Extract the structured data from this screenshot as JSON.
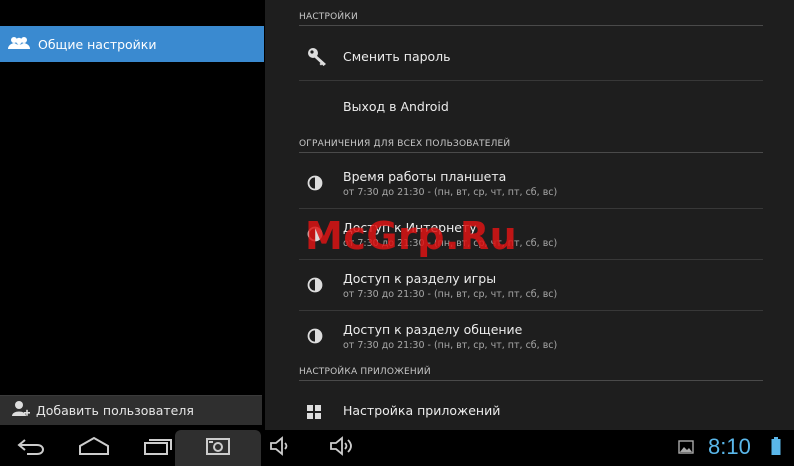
{
  "left_panel": {
    "general_settings": "Общие настройки",
    "add_user": "Добавить пользователя"
  },
  "right_panel": {
    "section_settings": "НАСТРОЙКИ",
    "change_password": "Сменить пароль",
    "exit_android": "Выход в Android",
    "section_restrictions": "ОГРАНИЧЕНИЯ ДЛЯ ВСЕХ ПОЛЬЗОВАТЕЛЕЙ",
    "restrictions": [
      {
        "title": "Время работы планшета",
        "sub": "от 7:30 до 21:30 - (пн, вт, ср, чт, пт, сб, вс)"
      },
      {
        "title": "Доступ к Интернету",
        "sub": "от 7:30 до 21:30 - (пн, вт, ср, чт, пт, сб, вс)"
      },
      {
        "title": "Доступ к разделу игры",
        "sub": "от 7:30 до 21:30 - (пн, вт, ср, чт, пт, сб, вс)"
      },
      {
        "title": "Доступ к разделу общение",
        "sub": "от 7:30 до 21:30 - (пн, вт, ср, чт, пт, сб, вс)"
      }
    ],
    "section_apps": "НАСТРОЙКА ПРИЛОЖЕНИЙ",
    "app_settings": "Настройка приложений"
  },
  "watermark": "McGrp.Ru",
  "status": {
    "time": "8:10",
    "accent_color": "#5ab7ea",
    "selected_color": "#3a8ad0"
  }
}
